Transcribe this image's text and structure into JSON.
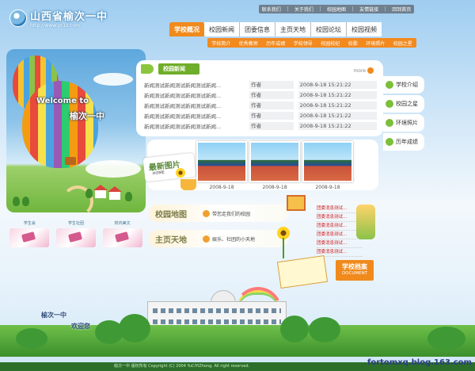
{
  "top_links": [
    "联系我们",
    "关于我们",
    "校园地图",
    "友情链接",
    "回到首页"
  ],
  "logo": {
    "title": "山西省榆次一中",
    "url": "http://www.yc1z.com"
  },
  "nav": {
    "items": [
      "学校概况",
      "校园新闻",
      "团委信息",
      "主页天地",
      "校园论坛",
      "校园视频"
    ],
    "active": "学校概况"
  },
  "subnav": [
    "学校简介",
    "优秀教师",
    "历年成绩",
    "学校领导",
    "校园校纪",
    "校歌",
    "环境照片",
    "校园之星"
  ],
  "hero": {
    "welcome": "Welcome to",
    "name": "榆次一中"
  },
  "thumbs": [
    "学生会",
    "学生社团",
    "校内美文"
  ],
  "news": {
    "title": "校园新闻",
    "more": "more",
    "rows": [
      {
        "title": "新闻测试新闻测试新闻测试新闻...",
        "author": "作者",
        "date": "2008-9-18 15:21:22"
      },
      {
        "title": "新闻测试新闻测试新闻测试新闻...",
        "author": "作者",
        "date": "2008-9-18 15:21:22"
      },
      {
        "title": "新闻测试新闻测试新闻测试新闻...",
        "author": "作者",
        "date": "2008-9-18 15:21:22"
      },
      {
        "title": "新闻测试新闻测试新闻测试新闻...",
        "author": "作者",
        "date": "2008-9-18 15:21:22"
      },
      {
        "title": "新闻测试新闻测试新闻测试新闻...",
        "author": "作者",
        "date": "2008-9-18 15:21:22"
      }
    ]
  },
  "right_menu": [
    "学校介绍",
    "校园之星",
    "环境照片",
    "历年成绩"
  ],
  "photos": {
    "label": "最新图片",
    "label_small": "HOME",
    "dates": [
      "2008-9-18",
      "2008-9-18",
      "2008-9-18"
    ]
  },
  "features": [
    {
      "title": "校园地图",
      "desc": "带您走我们的校园"
    },
    {
      "title": "主页天地",
      "desc": "娱乐、社团的小天地"
    }
  ],
  "right_news": [
    "团委消息测试...",
    "团委消息测试...",
    "团委消息测试...",
    "团委消息测试...",
    "团委消息测试...",
    "团委消息测试..."
  ],
  "document": {
    "cn": "学校档案",
    "en": "DOCUMENT"
  },
  "footer": {
    "title": "榆次一中",
    "subtitle": "欢迎您",
    "copyright": "榆次一中 版权所有 Copyright (C) 2004 YuCiYiZhong. All right reserved."
  },
  "watermark": "fortomxq.blog.163.com",
  "colors": {
    "accent": "#f08a1c",
    "green": "#6fae2a",
    "news_red": "#d02020"
  }
}
